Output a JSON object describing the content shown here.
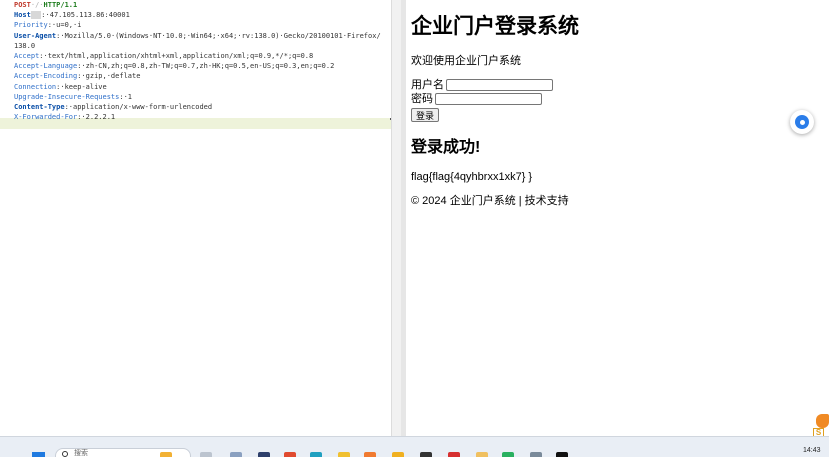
{
  "request": {
    "lines": [
      [
        {
          "t": "POST",
          "c": "m"
        },
        {
          "t": "·/·",
          "c": "dot"
        },
        {
          "t": "HTTP/1.1",
          "c": "v"
        }
      ],
      [
        {
          "t": "Host",
          "c": "k"
        },
        {
          "t": "  ",
          "c": "sel"
        },
        {
          "t": ":·47.105.113.86:40001",
          "c": "sep"
        }
      ],
      [
        {
          "t": "Priority",
          "c": "h"
        },
        {
          "t": ":·u=0,·i",
          "c": "sep"
        }
      ],
      [
        {
          "t": "User-Agent",
          "c": "k"
        },
        {
          "t": ":·Mozilla/5.0·(Windows·NT·10.0;·Win64;·x64;·rv:138.0)·Gecko/20100101·Firefox/",
          "c": "sep"
        }
      ],
      [
        {
          "t": "138.0",
          "c": "sep"
        }
      ],
      [
        {
          "t": "Accept",
          "c": "h"
        },
        {
          "t": ":·text/html,application/xhtml+xml,application/xml;q=0.9,*/*;q=0.8",
          "c": "sep"
        }
      ],
      [
        {
          "t": "Accept-Language",
          "c": "h"
        },
        {
          "t": ":·zh-CN,zh;q=0.8,zh-TW;q=0.7,zh-HK;q=0.5,en-US;q=0.3,en;q=0.2",
          "c": "sep"
        }
      ],
      [
        {
          "t": "Accept-Encoding",
          "c": "h"
        },
        {
          "t": ":·gzip,·deflate",
          "c": "sep"
        }
      ],
      [
        {
          "t": "Connection",
          "c": "h"
        },
        {
          "t": ":·keep-alive",
          "c": "sep"
        }
      ],
      [
        {
          "t": "Upgrade-Insecure-Requests",
          "c": "h"
        },
        {
          "t": ":·1",
          "c": "sep"
        }
      ],
      [
        {
          "t": "Content-Type",
          "c": "k"
        },
        {
          "t": ":·application/x-www-form-urlencoded",
          "c": "sep"
        }
      ],
      [
        {
          "t": "X-Forwarded-For",
          "c": "h"
        },
        {
          "t": ":·2.2.2.1",
          "c": "sep"
        }
      ]
    ]
  },
  "page": {
    "title": "企业门户登录系统",
    "welcome": "欢迎使用企业门户系统",
    "username_label": "用户名",
    "password_label": "密码",
    "login_label": "登录",
    "success_heading": "登录成功!",
    "flag": "flag{flag{4qyhbrxx1xk7} }",
    "footer": "© 2024 企业门户系统 | 技术支持"
  },
  "taskbar": {
    "search_placeholder": "搜索",
    "clock_time": "14:43"
  },
  "colors": {
    "header_key": "#0a4fa8",
    "header_name": "#2f6fc9",
    "method": "#c0392b",
    "protocol": "#1a7a1a",
    "caret_row": "#eef3da",
    "float_button": "#2b7de9",
    "taskbar": "#e9eef5"
  },
  "icons": [
    "windows-start-icon",
    "search-icon",
    "floating-assistant-icon",
    "mascot-icon"
  ]
}
